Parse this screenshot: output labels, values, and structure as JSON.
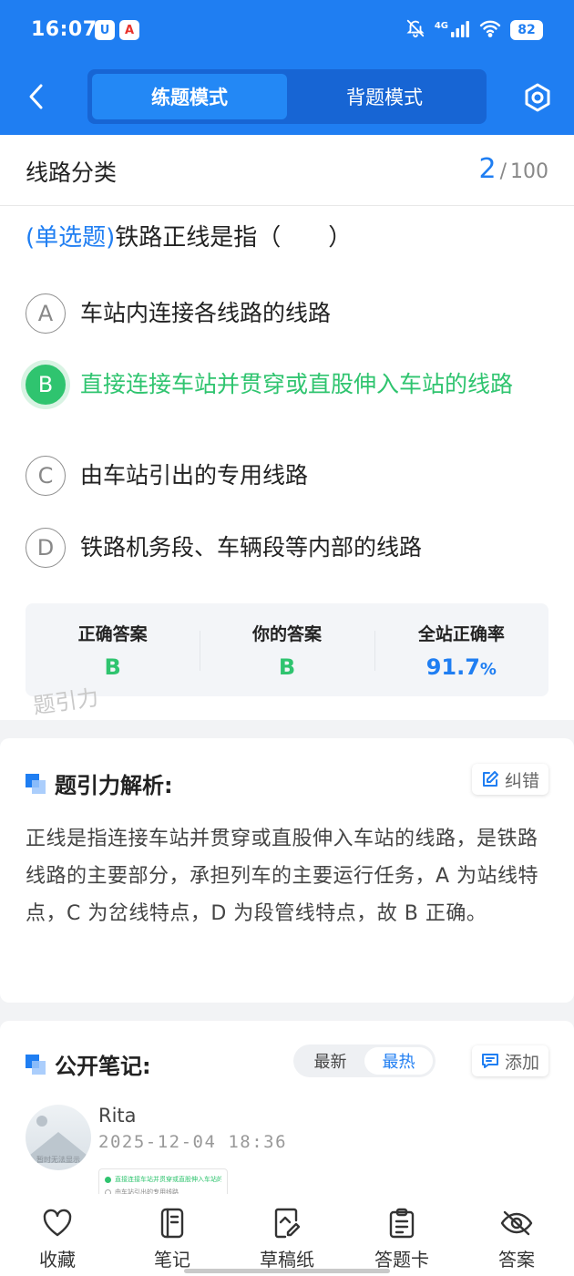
{
  "status_bar": {
    "time": "16:07",
    "app_icon_1": "U",
    "app_icon_2": "A",
    "network": "4G",
    "battery": "82"
  },
  "header": {
    "tabs": [
      "练题模式",
      "背题模式"
    ],
    "active_tab": 0
  },
  "chapter": {
    "title": "线路分类",
    "current": "2",
    "separator": "/",
    "total": "100"
  },
  "question": {
    "type": "(单选题)",
    "text": "铁路正线是指（　　）"
  },
  "options": [
    {
      "letter": "A",
      "text": "车站内连接各线路的线路",
      "state": "normal"
    },
    {
      "letter": "B",
      "text": "直接连接车站并贯穿或直股伸入车站的线路",
      "state": "correct"
    },
    {
      "letter": "C",
      "text": "由车站引出的专用线路",
      "state": "normal"
    },
    {
      "letter": "D",
      "text": "铁路机务段、车辆段等内部的线路",
      "state": "normal"
    }
  ],
  "answer_box": {
    "correct_label": "正确答案",
    "correct_value": "B",
    "yours_label": "你的答案",
    "yours_value": "B",
    "rate_label": "全站正确率",
    "rate_value": "91.7",
    "rate_unit": "%"
  },
  "watermark": "题引力",
  "analysis": {
    "title": "题引力解析:",
    "correct_button": "纠错",
    "text": "正线是指连接车站并贯穿或直股伸入车站的线路，是铁路线路的主要部分，承担列车的主要运行任务，A 为站线特点，C 为岔线特点，D 为段管线特点，故 B 正确。"
  },
  "notes": {
    "title": "公开笔记:",
    "sort_tabs": [
      "最新",
      "最热"
    ],
    "active_sort": 1,
    "add_button": "添加",
    "items": [
      {
        "user": "Rita",
        "time": "2025-12-04 18:36",
        "avatar_caption": "暂时无法显示",
        "thumb_lines": [
          "直接连接车站并贯穿或直股伸入车站的线路",
          "由车站引出的专用线路"
        ]
      }
    ]
  },
  "bottom_nav": [
    {
      "label": "收藏",
      "icon": "heart-icon"
    },
    {
      "label": "笔记",
      "icon": "notebook-icon"
    },
    {
      "label": "草稿纸",
      "icon": "draft-paper-icon"
    },
    {
      "label": "答题卡",
      "icon": "answer-card-icon"
    },
    {
      "label": "答案",
      "icon": "eye-off-icon"
    }
  ],
  "colors": {
    "primary": "#1f7ef2",
    "correct": "#2fc46f",
    "header_bg": "#1f7ef2"
  }
}
